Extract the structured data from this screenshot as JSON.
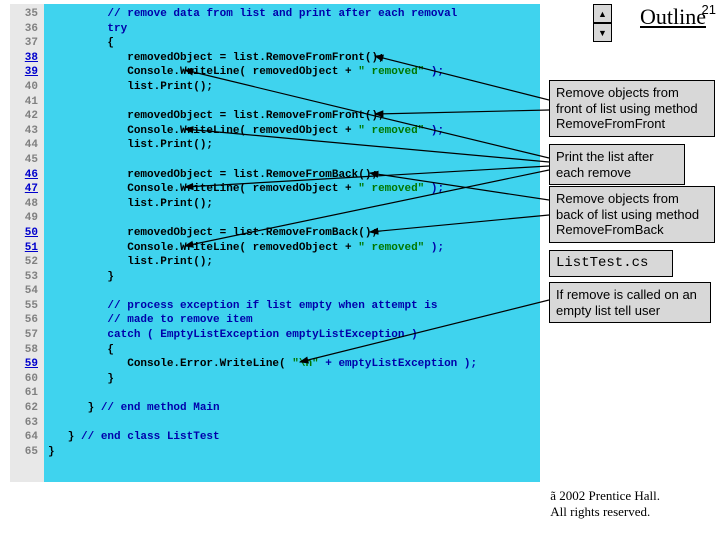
{
  "page_number": "21",
  "outline_heading": "Outline",
  "scrollbar": {
    "up": "▲",
    "down": "▼"
  },
  "gutter": {
    "start": 35,
    "end": 65,
    "linked": [
      38,
      39,
      46,
      47,
      50,
      51,
      59
    ]
  },
  "code": {
    "l35": {
      "a": "         ",
      "b": "// remove data from list and print after each removal"
    },
    "l36": {
      "a": "         ",
      "kw": "try"
    },
    "l37": {
      "a": "         {"
    },
    "l38": {
      "a": "            removedObject = list.RemoveFromFront();"
    },
    "l39": {
      "a": "            Console.WriteLine( removedObject + ",
      "q": "\" removed\"",
      "b": " );"
    },
    "l40": {
      "a": "            list.Print();"
    },
    "l41": {
      "a": ""
    },
    "l42": {
      "a": "            removedObject = list.RemoveFromFront();"
    },
    "l43": {
      "a": "            Console.WriteLine( removedObject + ",
      "q": "\" removed\"",
      "b": " );"
    },
    "l44": {
      "a": "            list.Print();"
    },
    "l45": {
      "a": ""
    },
    "l46": {
      "a": "            removedObject = list.RemoveFromBack();"
    },
    "l47": {
      "a": "            Console.WriteLine( removedObject + ",
      "q": "\" removed\"",
      "b": " );"
    },
    "l48": {
      "a": "            list.Print();"
    },
    "l49": {
      "a": ""
    },
    "l50": {
      "a": "            removedObject = list.RemoveFromBack();"
    },
    "l51": {
      "a": "            Console.WriteLine( removedObject + ",
      "q": "\" removed\"",
      "b": " );"
    },
    "l52": {
      "a": "            list.Print();"
    },
    "l53": {
      "a": "         }"
    },
    "l54": {
      "a": ""
    },
    "l55": {
      "a": "         ",
      "b": "// process exception if list empty when attempt is"
    },
    "l56": {
      "a": "         ",
      "b": "// made to remove item"
    },
    "l57": {
      "a": "         ",
      "kw": "catch",
      "b": " ( EmptyListException emptyListException )"
    },
    "l58": {
      "a": "         {"
    },
    "l59": {
      "a": "            Console.Error.WriteLine( ",
      "q": "\"\\n\"",
      "b": " + emptyListException );"
    },
    "l60": {
      "a": "         }"
    },
    "l61": {
      "a": ""
    },
    "l62": {
      "a": "      } ",
      "b": "// end method Main"
    },
    "l63": {
      "a": ""
    },
    "l64": {
      "a": "   } ",
      "b": "// end class ListTest"
    },
    "l65": {
      "a": "}"
    }
  },
  "notes": {
    "removeFront": "Remove objects from front of list using method RemoveFromFront",
    "printAfter": "Print the list after each remove",
    "removeBack": "Remove objects from back of list using method RemoveFromBack",
    "filename": "ListTest.cs",
    "emptyCatch": "If remove is called on an empty list tell user"
  },
  "footer": {
    "l1": "ã 2002 Prentice Hall.",
    "l2": "All rights reserved."
  }
}
